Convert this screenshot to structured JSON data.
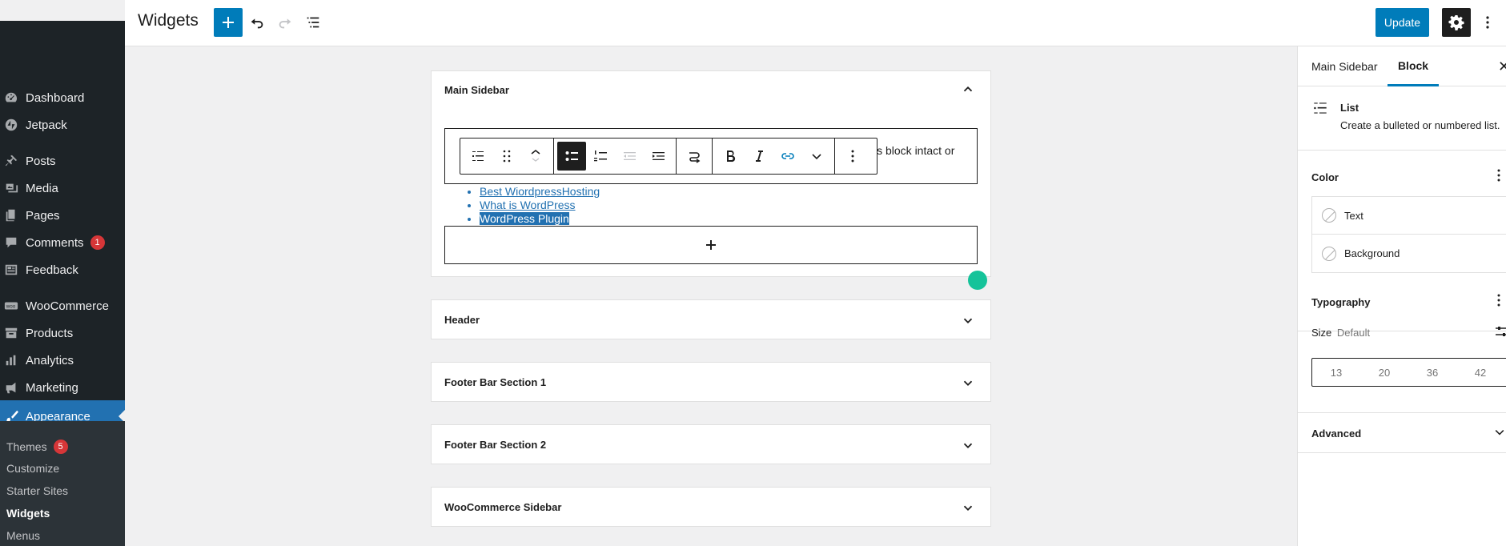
{
  "admin_menu": {
    "items": [
      {
        "label": "Dashboard",
        "icon": "dashboard-icon"
      },
      {
        "label": "Jetpack",
        "icon": "jetpack-icon"
      },
      {
        "label": "Posts",
        "icon": "pin-icon"
      },
      {
        "label": "Media",
        "icon": "media-icon"
      },
      {
        "label": "Pages",
        "icon": "pages-icon"
      },
      {
        "label": "Comments",
        "icon": "comments-icon",
        "badge": "1"
      },
      {
        "label": "Feedback",
        "icon": "feedback-icon"
      },
      {
        "label": "WooCommerce",
        "icon": "woocommerce-icon"
      },
      {
        "label": "Products",
        "icon": "archive-icon"
      },
      {
        "label": "Analytics",
        "icon": "chart-bar-icon"
      },
      {
        "label": "Marketing",
        "icon": "megaphone-icon"
      },
      {
        "label": "Appearance",
        "icon": "paintbrush-icon"
      }
    ],
    "submenu": [
      {
        "label": "Themes",
        "badge": "5"
      },
      {
        "label": "Customize"
      },
      {
        "label": "Starter Sites"
      },
      {
        "label": "Widgets"
      },
      {
        "label": "Menus"
      }
    ]
  },
  "header": {
    "title": "Widgets",
    "update_label": "Update"
  },
  "canvas": {
    "main_sidebar": {
      "title": "Main Sidebar",
      "block_text": "is block intact or",
      "list_items": [
        "Best WiordpressHosting",
        "What is WordPress",
        "WordPress Plugin"
      ]
    },
    "areas": [
      "Header",
      "Footer Bar Section 1",
      "Footer Bar Section 2",
      "WooCommerce Sidebar"
    ]
  },
  "settings": {
    "tabs": [
      "Main Sidebar",
      "Block"
    ],
    "block": {
      "name": "List",
      "description": "Create a bulleted or numbered list."
    },
    "color": {
      "title": "Color",
      "items": [
        "Text",
        "Background"
      ]
    },
    "typography": {
      "title": "Typography",
      "size_label": "Size",
      "size_value": "Default",
      "sizes": [
        "13",
        "20",
        "36",
        "42"
      ]
    },
    "advanced": {
      "title": "Advanced"
    }
  }
}
